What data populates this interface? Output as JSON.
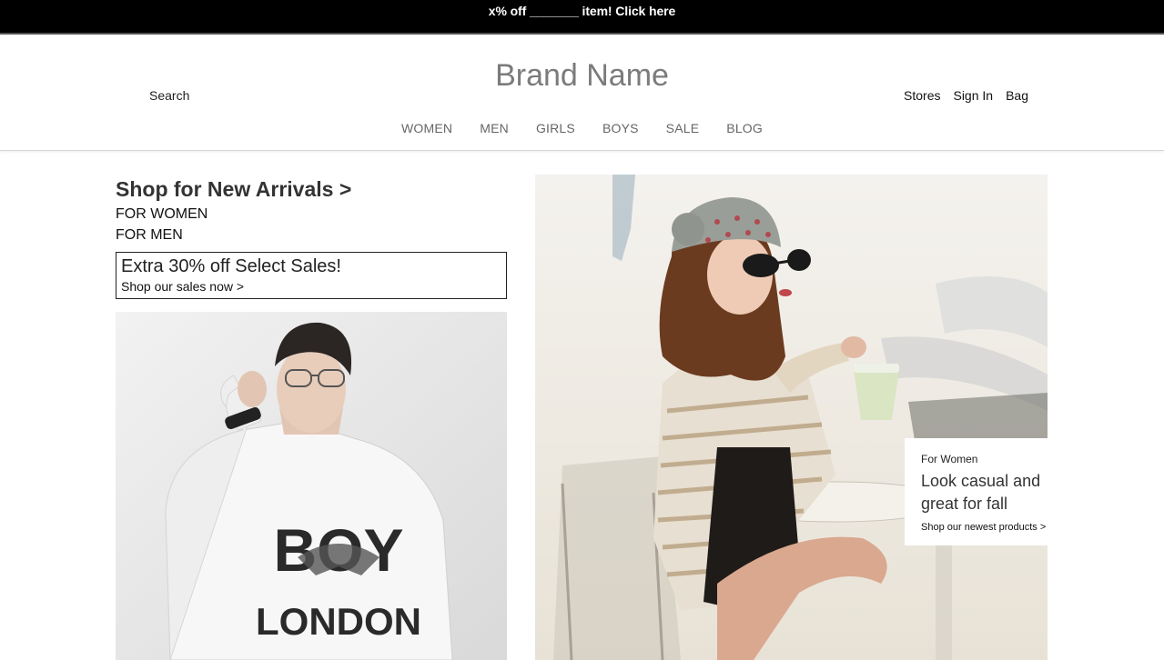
{
  "promo": {
    "text": "x% off _______ item! Click here"
  },
  "header": {
    "search_label": "Search",
    "brand": "Brand Name",
    "util_nav": [
      "Stores",
      "Sign In",
      "Bag"
    ],
    "main_nav": [
      "WOMEN",
      "MEN",
      "GIRLS",
      "BOYS",
      "SALE",
      "BLOG"
    ]
  },
  "left": {
    "heading": "Shop for New Arrivals >",
    "links": [
      "FOR WOMEN",
      "FOR MEN"
    ],
    "sale_box": {
      "title": "Extra 30% off Select Sales!",
      "subtitle": "Shop our sales now >"
    },
    "image_shirt_text": [
      "BOY",
      "LONDON"
    ]
  },
  "feature": {
    "category": "For Women",
    "title_line1": "Look casual and",
    "title_line2": "great for fall",
    "link": "Shop our newest products >"
  },
  "colors": {
    "promo_bg": "#000000",
    "brand": "#7b7b7b",
    "nav": "#666666"
  }
}
